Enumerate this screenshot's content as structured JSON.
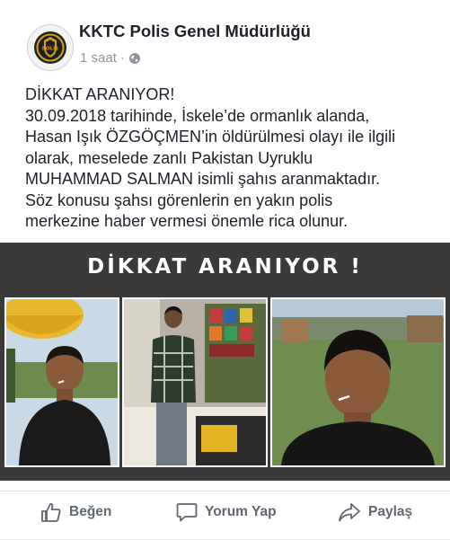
{
  "post": {
    "page_name": "KKTC Polis Genel Müdürlüğü",
    "time": "1 saat",
    "separator": "·",
    "privacy_icon": "globe-icon",
    "avatar_text": "POLİS",
    "text_lines": [
      "DİKKAT ARANIYOR!",
      "30.09.2018 tarihinde, İskele’de ormanlık alanda,",
      "Hasan Işık ÖZGÖÇMEN’in öldürülmesi olayı ile ilgili",
      "olarak, meselede zanlı Pakistan Uyruklu",
      "MUHAMMAD SALMAN isimli şahıs aranmaktadır.",
      "Söz konusu şahsı görenlerin en yakın polis",
      "merkezine haber vermesi önemle rica olunur."
    ]
  },
  "image": {
    "banner_title": "DİKKAT ARANIYOR !"
  },
  "actions": {
    "like": "Beğen",
    "comment": "Yorum Yap",
    "share": "Paylaş"
  },
  "colors": {
    "text": "#1d2129",
    "meta": "#90949c",
    "action": "#606770",
    "banner_bg": "#3a3a3a"
  }
}
